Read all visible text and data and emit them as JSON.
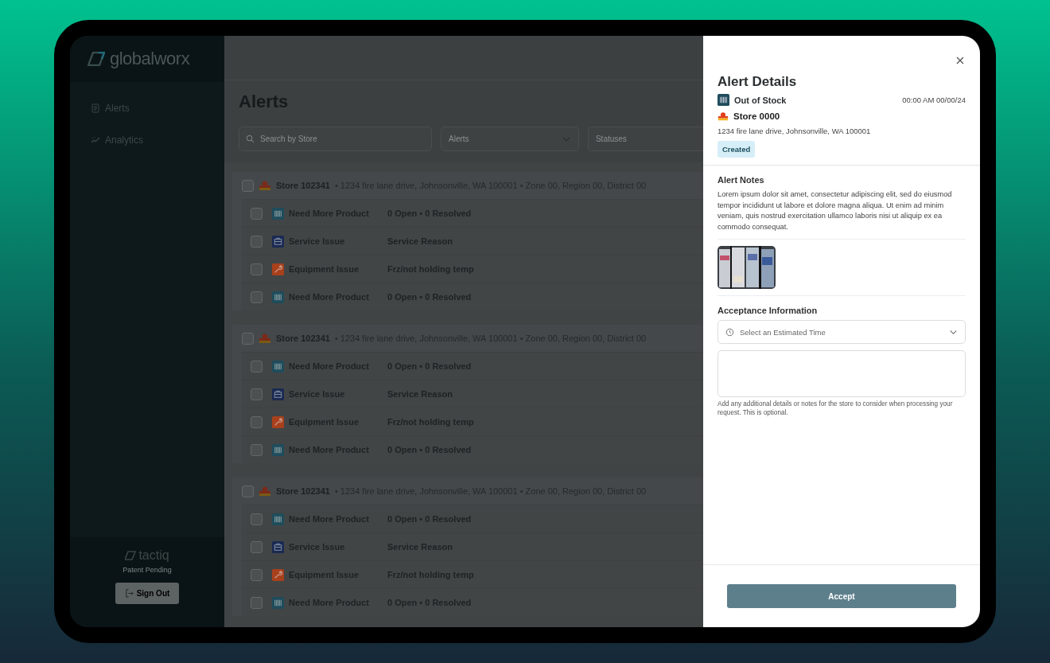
{
  "sidebar": {
    "logo": "globalworx",
    "items": [
      {
        "label": "Alerts"
      },
      {
        "label": "Analytics"
      }
    ],
    "brand": "tactiq",
    "brand_note": "Patent Pending",
    "sign_out": "Sign Out"
  },
  "page": {
    "title": "Alerts",
    "filters": {
      "search_placeholder": "Search by Store",
      "alerts_placeholder": "Alerts",
      "statuses_placeholder": "Statuses"
    }
  },
  "stores": [
    {
      "name": "Store 102341",
      "details": "• 1234 fire lane drive, Johnsonville, WA 100001 • Zone 00, Region 00, District 00",
      "checked": false,
      "alerts": [
        {
          "kind": "product",
          "type": "Need More Product",
          "info": "0 Open • 0 Resolved",
          "checked": false
        },
        {
          "kind": "service",
          "type": "Service Issue",
          "info": "Service Reason",
          "checked": false
        },
        {
          "kind": "equipment",
          "type": "Equipment Issue",
          "info": "Frz/not holding temp",
          "checked": false
        },
        {
          "kind": "product",
          "type": "Need More Product",
          "info": "0 Open • 0 Resolved",
          "checked": false
        }
      ]
    },
    {
      "name": "Store 102341",
      "details": "• 1234 fire lane drive, Johnsonville, WA 100001 • Zone 00, Region 00, District 00",
      "checked": false,
      "alerts": [
        {
          "kind": "product",
          "type": "Need More Product",
          "info": "0 Open • 0 Resolved",
          "checked": false
        },
        {
          "kind": "service",
          "type": "Service Issue",
          "info": "Service Reason",
          "checked": false
        },
        {
          "kind": "equipment",
          "type": "Equipment Issue",
          "info": "Frz/not holding temp",
          "checked": false
        },
        {
          "kind": "product",
          "type": "Need More Product",
          "info": "0 Open • 0 Resolved",
          "checked": false
        }
      ]
    },
    {
      "name": "Store 102341",
      "details": "• 1234 fire lane drive, Johnsonville, WA 100001 • Zone 00, Region 00, District 00",
      "checked": false,
      "alerts": [
        {
          "kind": "product",
          "type": "Need More Product",
          "info": "0 Open • 0 Resolved",
          "checked": false
        },
        {
          "kind": "service",
          "type": "Service Issue",
          "info": "Service Reason",
          "checked": false
        },
        {
          "kind": "equipment",
          "type": "Equipment Issue",
          "info": "Frz/not holding temp",
          "checked": false
        },
        {
          "kind": "product",
          "type": "Need More Product",
          "info": "0 Open • 0 Resolved",
          "checked": false
        }
      ]
    }
  ],
  "drawer": {
    "title": "Alert Details",
    "alert_type": "Out of Stock",
    "time": "00:00 AM 00/00/24",
    "store": "Store 0000",
    "address": "1234 fire lane drive, Johnsonville, WA 100001",
    "status": "Created",
    "notes_heading": "Alert Notes",
    "notes": "Lorem ipsum dolor sit amet, consectetur adipiscing elit, sed do eiusmod tempor incididunt ut labore et dolore magna aliqua. Ut enim ad minim veniam, quis nostrud exercitation ullamco laboris nisi ut aliquip ex ea commodo consequat.",
    "acceptance_heading": "Acceptance Information",
    "time_select": {
      "placeholder": "Select an Estimated Time"
    },
    "notes_field_help": "Add any additional details or notes for the store to consider when processing your request. This is optional.",
    "accept_button": "Accept"
  }
}
